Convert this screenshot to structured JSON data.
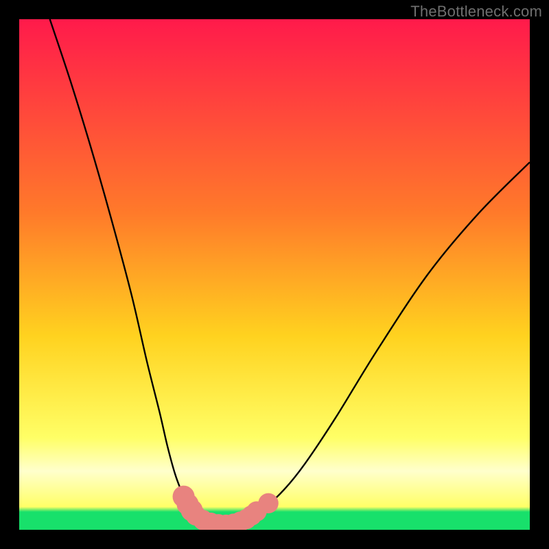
{
  "watermark": "TheBottleneck.com",
  "colors": {
    "frame": "#000000",
    "grad_top": "#ff1a4b",
    "grad_mid1": "#ff7a2a",
    "grad_mid2": "#ffd21f",
    "grad_low": "#ffff66",
    "grad_band_pale": "#ffffcc",
    "grad_green": "#18e06b",
    "curve": "#000000",
    "marker": "#e8837f"
  },
  "chart_data": {
    "type": "line",
    "title": "",
    "xlabel": "",
    "ylabel": "",
    "xlim": [
      0,
      100
    ],
    "ylim": [
      0,
      100
    ],
    "series": [
      {
        "name": "left-branch",
        "x": [
          6,
          10,
          14,
          18,
          22,
          25,
          27.5,
          29,
          30.5,
          31.8,
          33,
          34,
          35
        ],
        "y": [
          100,
          88,
          75,
          61,
          46,
          33,
          23,
          16.5,
          11,
          7.5,
          5,
          3.2,
          2.3
        ]
      },
      {
        "name": "valley",
        "x": [
          35,
          36.5,
          38,
          40,
          42,
          43.5,
          45
        ],
        "y": [
          2.3,
          1.6,
          1.2,
          1.0,
          1.2,
          1.6,
          2.3
        ]
      },
      {
        "name": "right-branch",
        "x": [
          45,
          48,
          52,
          56,
          62,
          70,
          80,
          90,
          100
        ],
        "y": [
          2.3,
          4.2,
          8,
          13,
          22,
          35,
          50,
          62,
          72
        ]
      }
    ],
    "markers": [
      {
        "x": 32.2,
        "y": 6.5,
        "r": 1.8
      },
      {
        "x": 33.0,
        "y": 5.0,
        "r": 1.8
      },
      {
        "x": 33.8,
        "y": 3.8,
        "r": 1.8
      },
      {
        "x": 34.6,
        "y": 2.8,
        "r": 1.6
      },
      {
        "x": 36.0,
        "y": 1.9,
        "r": 1.6
      },
      {
        "x": 37.5,
        "y": 1.4,
        "r": 1.6
      },
      {
        "x": 39.0,
        "y": 1.1,
        "r": 1.6
      },
      {
        "x": 40.5,
        "y": 1.0,
        "r": 1.6
      },
      {
        "x": 42.0,
        "y": 1.2,
        "r": 1.6
      },
      {
        "x": 43.3,
        "y": 1.6,
        "r": 1.6
      },
      {
        "x": 44.5,
        "y": 2.1,
        "r": 1.6
      },
      {
        "x": 45.5,
        "y": 2.8,
        "r": 1.6
      },
      {
        "x": 46.5,
        "y": 3.6,
        "r": 1.6
      },
      {
        "x": 48.8,
        "y": 5.2,
        "r": 1.6
      }
    ],
    "gradient_stops": [
      {
        "offset": 0.0,
        "key": "grad_top"
      },
      {
        "offset": 0.38,
        "key": "grad_mid1"
      },
      {
        "offset": 0.62,
        "key": "grad_mid2"
      },
      {
        "offset": 0.82,
        "key": "grad_low"
      },
      {
        "offset": 0.885,
        "key": "grad_band_pale"
      },
      {
        "offset": 0.955,
        "key": "grad_low"
      },
      {
        "offset": 0.965,
        "key": "grad_green"
      },
      {
        "offset": 1.0,
        "key": "grad_green"
      }
    ]
  }
}
